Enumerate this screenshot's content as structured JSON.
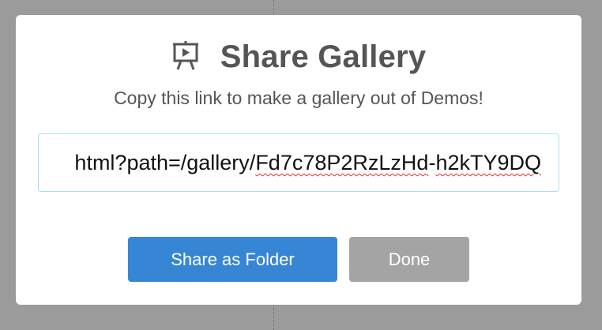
{
  "dialog": {
    "title": "Share Gallery",
    "icon": "presentation-board-icon",
    "subtitle": "Copy this link to make a gallery out of Demos!",
    "link": {
      "prefix": "html?path=/gallery/",
      "token_part1": "Fd7c78P2RzLzHd",
      "separator": "-",
      "token_part2": "h2kTY9DQ"
    },
    "buttons": {
      "share_as_folder": "Share as Folder",
      "done": "Done"
    }
  },
  "colors": {
    "backdrop": "#9b9b9b",
    "primary_button": "#3786d6",
    "secondary_button": "#a4a4a4",
    "input_border": "#a9dff0",
    "title_text": "#555555"
  }
}
